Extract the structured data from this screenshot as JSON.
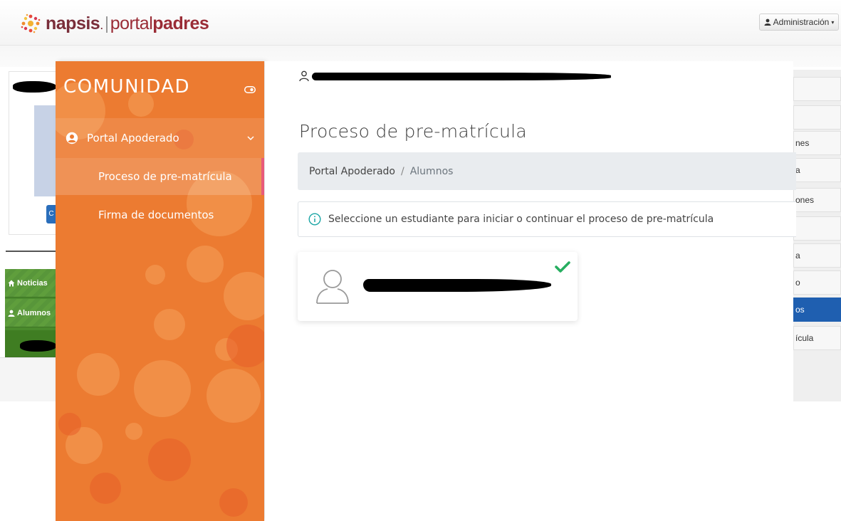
{
  "header": {
    "logo": {
      "napsis": "napsis",
      "dot": ".",
      "separator": "|",
      "portal": "portal",
      "padres": "padres"
    },
    "admin_menu": {
      "label": "Administración",
      "icon": "user-icon",
      "caret": "▾"
    }
  },
  "background": {
    "profile_button_initial": "C",
    "green_menu": [
      {
        "icon": "home-icon",
        "label": "Noticias"
      },
      {
        "icon": "user-icon",
        "label": "Alumnos"
      }
    ],
    "right_menu": [
      {
        "label": ""
      },
      {
        "label": ""
      },
      {
        "label": "nes"
      },
      {
        "label": "a"
      },
      {
        "label": "ones"
      },
      {
        "label": ""
      },
      {
        "label": "a"
      },
      {
        "label": "o"
      },
      {
        "label": "os",
        "active": true
      },
      {
        "label": "ícula"
      }
    ]
  },
  "sidebar": {
    "title": "COMUNIDAD",
    "toggle_icon": "toggle-icon",
    "parent": {
      "label": "Portal Apoderado",
      "icon": "user-circle-icon",
      "expanded": true
    },
    "items": [
      {
        "label": "Proceso de pre-matrícula",
        "active": true
      },
      {
        "label": "Firma de documentos",
        "active": false
      }
    ],
    "colors": {
      "background": "#ec7b31",
      "active_marker": "#e85a7a"
    }
  },
  "main": {
    "page_title": "Proceso de pre-matrícula",
    "breadcrumb": {
      "parent": "Portal Apoderado",
      "separator": "/",
      "current": "Alumnos"
    },
    "alert": {
      "icon": "info-icon",
      "message": "Seleccione un estudiante para iniciar o continuar el proceso de pre-matrícula"
    },
    "student_card": {
      "avatar_icon": "user-outline-icon",
      "status_icon": "check-icon",
      "status_color": "#27ae60"
    }
  }
}
